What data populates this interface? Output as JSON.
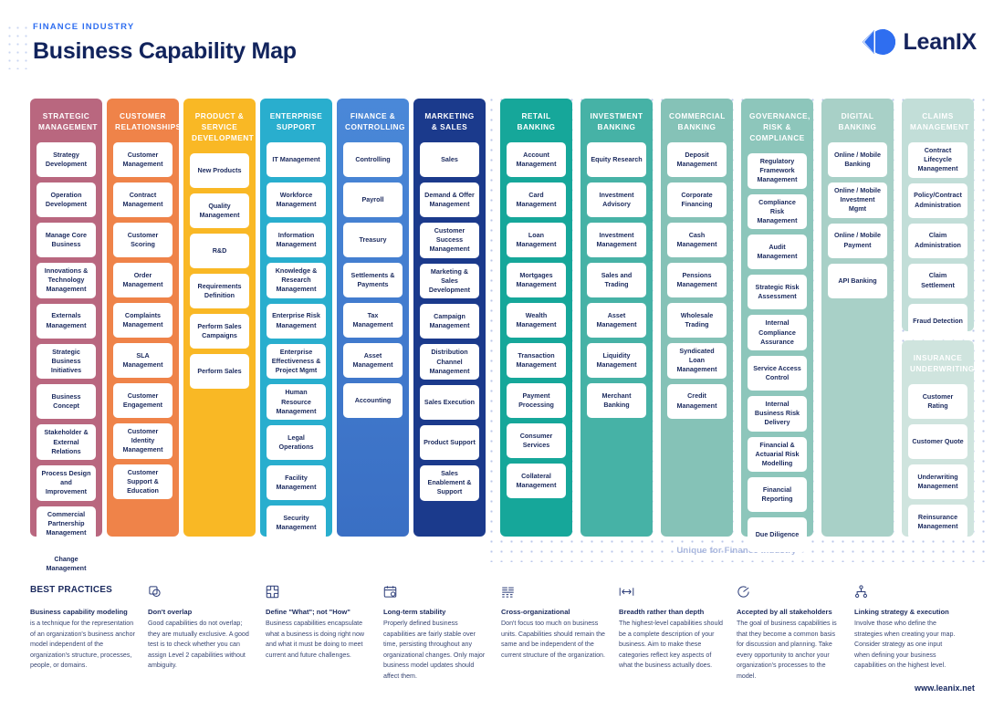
{
  "header": {
    "eyebrow": "FINANCE INDUSTRY",
    "title": "Business Capability Map",
    "logo_text": "LeanIX"
  },
  "industry_note": "Unique for Finance Industry",
  "footer": {
    "url": "www.leanix.net"
  },
  "colors": {
    "strategic_management": "#b9677f",
    "customer_relationships": "#ef8349",
    "product_service_development": "#f9b825",
    "enterprise_support": "#29aece",
    "finance_controlling": "#4a88d8",
    "marketing_sales": "#1b3a8c",
    "retail_banking": "#16a79a",
    "investment_banking": "#46b2a6",
    "commercial_banking": "#85c2b7",
    "governance_risk_compliance": "#8dc6bb",
    "digital_banking": "#a8d0c7",
    "claims_management": "#c2ded8",
    "insurance_underwriting": "#cfe4de",
    "accent_blue": "#2f6ef0",
    "navy": "#11235c",
    "dot_grid": "#b9c6ea"
  },
  "columns": [
    {
      "id": "strategic-management",
      "title": "STRATEGIC MANAGEMENT",
      "capabilities": [
        "Strategy Development",
        "Operation Development",
        "Manage Core Business",
        "Innovations & Technology Management",
        "Externals Management",
        "Strategic Business Initiatives",
        "Business Concept",
        "Stakeholder & External Relations",
        "Process Design and Improvement",
        "Commercial Partnership Management",
        "Change Management"
      ]
    },
    {
      "id": "customer-relationships",
      "title": "CUSTOMER RELATIONSHIPS",
      "capabilities": [
        "Customer Management",
        "Contract Management",
        "Customer Scoring",
        "Order Management",
        "Complaints Management",
        "SLA Management",
        "Customer Engagement",
        "Customer Identity Management",
        "Customer Support & Education"
      ]
    },
    {
      "id": "product-service-development",
      "title": "PRODUCT & SERVICE DEVELOPMENT",
      "capabilities": [
        "New Products",
        "Quality Management",
        "R&D",
        "Requirements Definition",
        "Perform Sales Campaigns",
        "Perform Sales"
      ]
    },
    {
      "id": "enterprise-support",
      "title": "ENTERPRISE SUPPORT",
      "capabilities": [
        "IT Management",
        "Workforce Management",
        "Information Management",
        "Knowledge & Research Management",
        "Enterprise Risk Management",
        "Enterprise Effectiveness & Project Mgmt",
        "Human Resource Management",
        "Legal Operations",
        "Facility Management",
        "Security Management"
      ]
    },
    {
      "id": "finance-controlling",
      "title": "FINANCE & CONTROLLING",
      "capabilities": [
        "Controlling",
        "Payroll",
        "Treasury",
        "Settlements & Payments",
        "Tax Management",
        "Asset Management",
        "Accounting"
      ]
    },
    {
      "id": "marketing-sales",
      "title": "MARKETING & SALES",
      "capabilities": [
        "Sales",
        "Demand & Offer Management",
        "Customer Success Management",
        "Marketing & Sales Development",
        "Campaign Management",
        "Distribution Channel Management",
        "Sales Execution",
        "Product Support",
        "Sales Enablement & Support"
      ]
    },
    {
      "id": "retail-banking",
      "title": "RETAIL BANKING",
      "capabilities": [
        "Account Management",
        "Card Management",
        "Loan Management",
        "Mortgages Management",
        "Wealth Management",
        "Transaction Management",
        "Payment Processing",
        "Consumer Services",
        "Collateral Management"
      ]
    },
    {
      "id": "investment-banking",
      "title": "INVESTMENT BANKING",
      "capabilities": [
        "Equity Research",
        "Investment Advisory",
        "Investment Management",
        "Sales and Trading",
        "Asset Management",
        "Liquidity Management",
        "Merchant Banking"
      ]
    },
    {
      "id": "commercial-banking",
      "title": "COMMERCIAL BANKING",
      "capabilities": [
        "Deposit Management",
        "Corporate Financing",
        "Cash Management",
        "Pensions Management",
        "Wholesale Trading",
        "Syndicated Loan Management",
        "Credit Management"
      ]
    },
    {
      "id": "governance-risk-compliance",
      "title": "GOVERNANCE, RISK & COMPLIANCE",
      "capabilities": [
        "Regulatory Framework Management",
        "Compliance Risk Management",
        "Audit Management",
        "Strategic Risk Assessment",
        "Internal Compliance Assurance",
        "Service Access Control",
        "Internal Business Risk Delivery",
        "Financial & Actuarial Risk  Modelling",
        "Financial Reporting",
        "Due Diligence"
      ]
    },
    {
      "id": "digital-banking",
      "title": "DIGITAL BANKING",
      "capabilities": [
        "Online / Mobile Banking",
        "Online / Mobile Investment Mgmt",
        "Online / Mobile Payment",
        "API Banking"
      ]
    },
    {
      "id": "claims-management",
      "title": "CLAIMS MANAGEMENT",
      "capabilities": [
        "Contract Lifecycle Management",
        "Policy/Contract Administration",
        "Claim Administration",
        "Claim Settlement",
        "Fraud Detection"
      ]
    },
    {
      "id": "insurance-underwriting",
      "title": "INSURANCE UNDERWRITING",
      "capabilities": [
        "Customer Rating",
        "Customer Quote",
        "Underwriting Management",
        "Reinsurance Management"
      ]
    }
  ],
  "best_practices": {
    "heading": "BEST PRACTICES",
    "items": [
      {
        "icon": "",
        "title": "Business capability modeling",
        "body": "is a technique for the representation of an organization's business anchor model independent of the organization's structure, processes, people, or domains."
      },
      {
        "icon": "no-overlap-icon",
        "title": "Don't overlap",
        "body": "Good capabilities do not overlap; they are mutually exclusive. A good test is to check whether you can assign Level 2 capabilities without ambiguity."
      },
      {
        "icon": "blocks-icon",
        "title": "Define \"What\"; not \"How\"",
        "body": "Business capabilities encapsulate what a business is doing right now and what it must be doing to meet current and future challenges."
      },
      {
        "icon": "calendar-clock-icon",
        "title": "Long-term stability",
        "body": "Properly defined business capabilities are fairly stable over time, persisting throughout any organizational changes. Only major business model updates should affect them."
      },
      {
        "icon": "org-layers-icon",
        "title": "Cross-organizational",
        "body": "Don't focus too much on business units. Capabilities should remain the same and be independent of the current structure of the organization."
      },
      {
        "icon": "width-arrows-icon",
        "title": "Breadth rather than depth",
        "body": "The highest-level capabilities should be a complete description of your business. Aim to make these categories reflect key aspects of what the business actually does."
      },
      {
        "icon": "check-circle-icon",
        "title": "Accepted by all stakeholders",
        "body": "The goal of business capabilities is that they become a common basis for discussion and planning. Take every opportunity to anchor your organization's processes to the model."
      },
      {
        "icon": "hierarchy-icon",
        "title": "Linking strategy & execution",
        "body": "Involve those who define the strategies when creating your map. Consider strategy as one input when defining your business capabilities on the highest level."
      }
    ]
  }
}
